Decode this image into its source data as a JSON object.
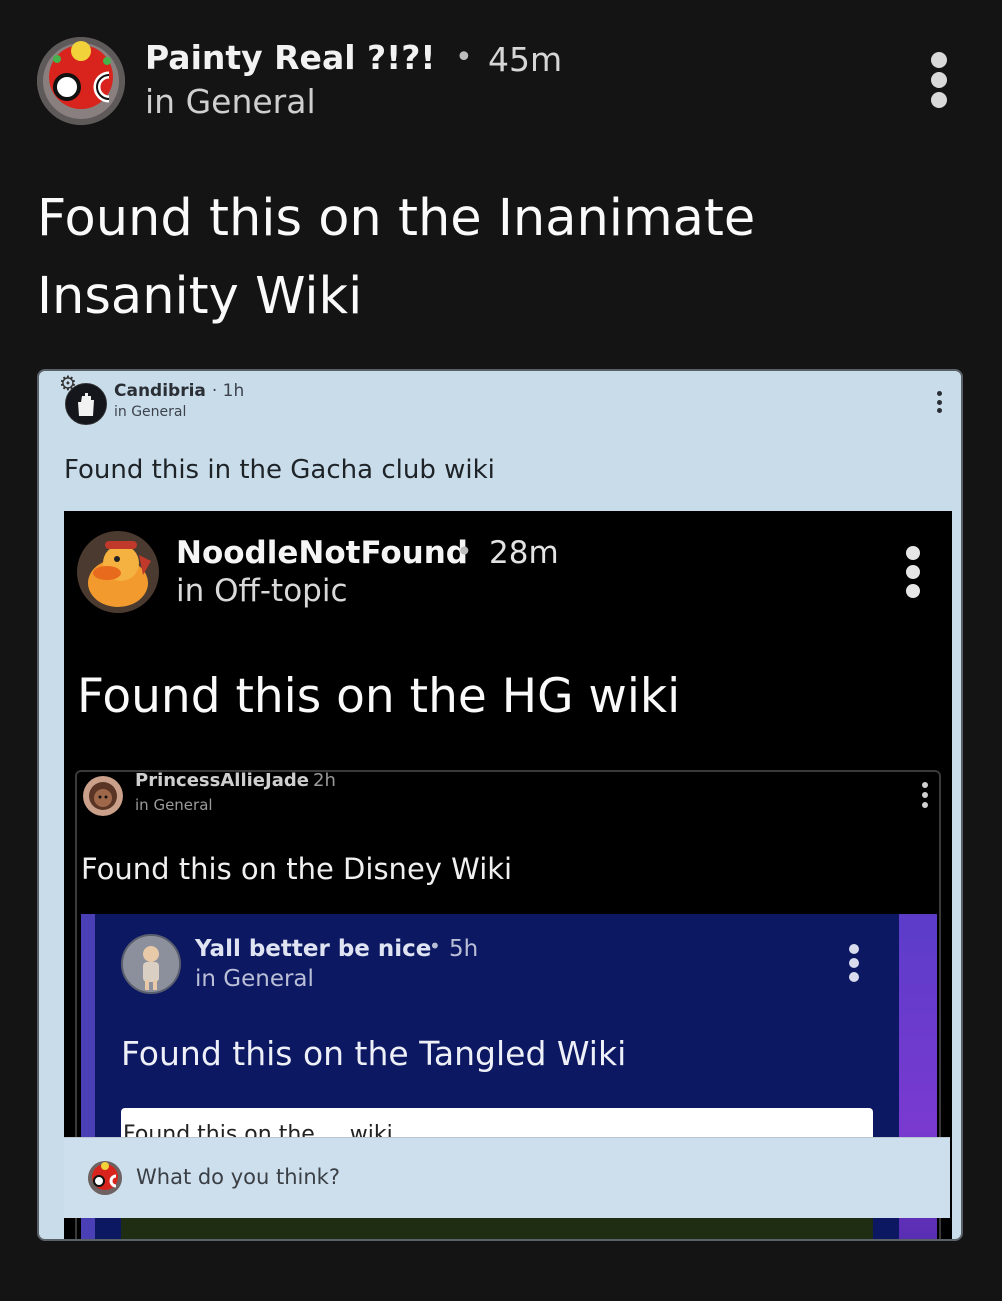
{
  "post": {
    "author": "Painty Real ?!?!",
    "time": "45m",
    "category": "in General",
    "title": "Found this on the Inanimate Insanity Wiki",
    "separator": "•"
  },
  "nested1": {
    "author": "Candibria",
    "separator": "·",
    "time": "1h",
    "category": "in General",
    "title": "Found this in the Gacha club wiki"
  },
  "nested2": {
    "author": "NoodleNotFound",
    "separator": "•",
    "time": "28m",
    "category": "in Off-topic",
    "title": "Found this on the HG wiki"
  },
  "nested3": {
    "author": "PrincessAllieJade",
    "separator": "·",
    "time": "2h",
    "category": "in General",
    "title": "Found this on the Disney Wiki"
  },
  "nested4": {
    "author": "Yall better be nice",
    "separator": "•",
    "time": "5h",
    "category": "in General",
    "title": "Found this on the Tangled Wiki"
  },
  "nested5": {
    "title_peek": "Found this on the ... wiki"
  },
  "comment": {
    "placeholder": "What do you think?"
  },
  "colors": {
    "background": "#141415",
    "light_panel": "#c9dcea",
    "navy_panel": "#0d1863"
  }
}
